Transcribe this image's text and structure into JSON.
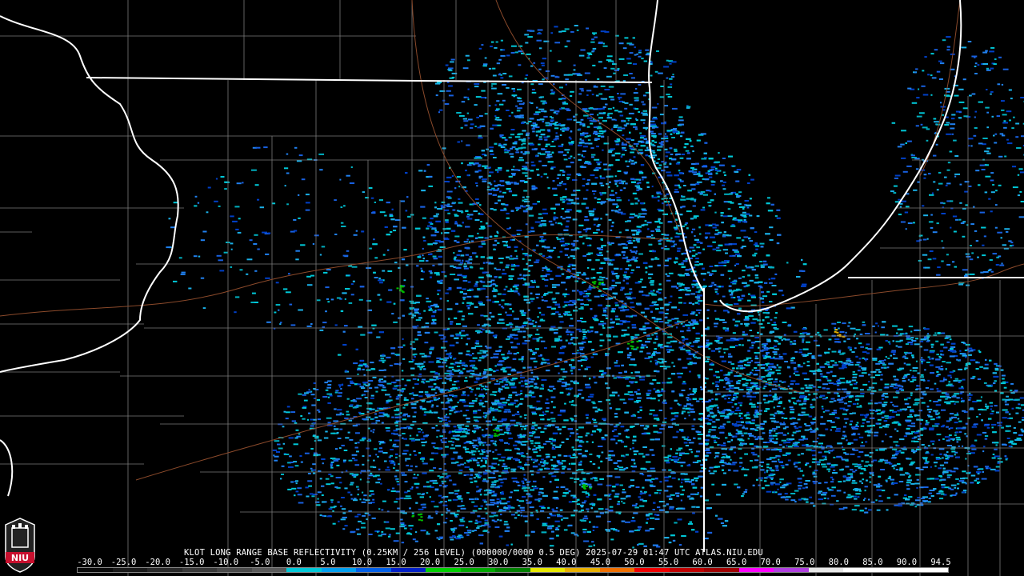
{
  "header": {
    "product_line": "KLOT LONG RANGE BASE REFLECTIVITY (0.25KM / 256 LEVEL) (000000/0000 0.5 DEG) 2025-07-29 01:47 UTC  ATLAS.NIU.EDU"
  },
  "scale": {
    "labels": [
      "-30.0",
      "-25.0",
      "-20.0",
      "-15.0",
      "-10.0",
      "-5.0",
      "0.0",
      "5.0",
      "10.0",
      "15.0",
      "20.0",
      "25.0",
      "30.0",
      "35.0",
      "40.0",
      "45.0",
      "50.0",
      "55.0",
      "60.0",
      "65.0",
      "70.0",
      "75.0",
      "80.0",
      "85.0",
      "90.0",
      "94.5"
    ],
    "colors": [
      "#0b0b0b",
      "#1a1a1a",
      "#2a2a2a",
      "#3a3a3a",
      "#4a4a4a",
      "#5a5a5a",
      "#00c8d8",
      "#00a0f0",
      "#0060e8",
      "#0020c8",
      "#00d000",
      "#00a800",
      "#008000",
      "#e8e800",
      "#e8b000",
      "#f07000",
      "#f00000",
      "#c00000",
      "#a00000",
      "#ff00ff",
      "#b040e0",
      "#e8e8e8",
      "#ffffff",
      "#ffffff",
      "#ffffff"
    ]
  },
  "logo": {
    "text": "NIU",
    "color": "#c8102e"
  },
  "map": {
    "state_line_color": "#ffffff",
    "county_line_color": "#7a7a7a",
    "road_color": "#8b4a2b",
    "echo_colors": [
      "#00c8d8",
      "#1ab0e8",
      "#2080f0",
      "#1860e0",
      "#0040c8",
      "#00b0c0"
    ]
  }
}
